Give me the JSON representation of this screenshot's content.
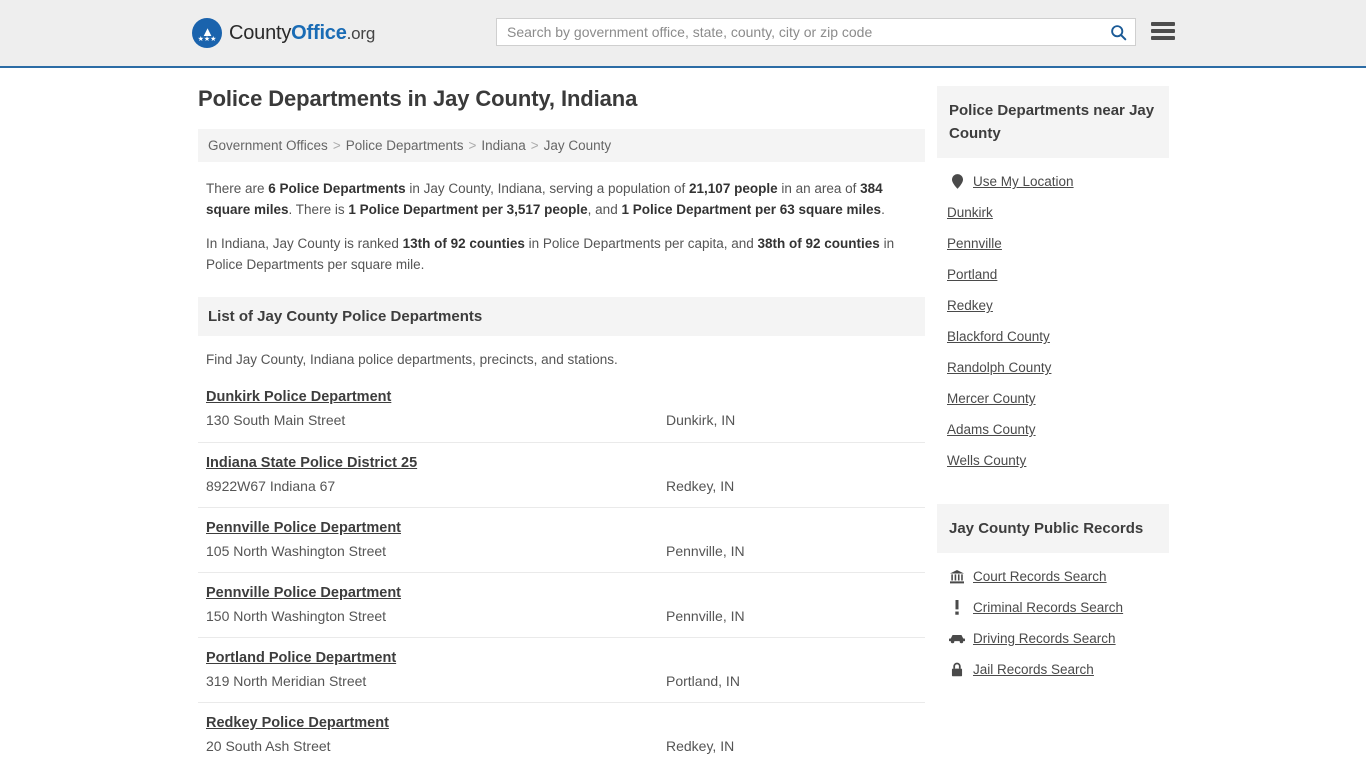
{
  "header": {
    "brand": {
      "part1": "County",
      "part2": "Office",
      "part3": ".org",
      "logo_icon": "eagle-seal-icon"
    },
    "search": {
      "placeholder": "Search by government office, state, county, city or zip code",
      "value": "",
      "search_icon": "search-icon"
    },
    "menu_icon": "hamburger-menu-icon",
    "accent_color": "#2c6ca5"
  },
  "main": {
    "title": "Police Departments in Jay County, Indiana",
    "breadcrumb": [
      {
        "label": "Government Offices"
      },
      {
        "label": "Police Departments"
      },
      {
        "label": "Indiana"
      },
      {
        "label": "Jay County"
      }
    ],
    "breadcrumb_separator": ">",
    "stats": {
      "paragraph1_parts": [
        {
          "text": "There are ",
          "bold": false
        },
        {
          "text": "6 Police Departments",
          "bold": true
        },
        {
          "text": " in Jay County, Indiana, serving a population of ",
          "bold": false
        },
        {
          "text": "21,107 people",
          "bold": true
        },
        {
          "text": " in an area of ",
          "bold": false
        },
        {
          "text": "384 square miles",
          "bold": true
        },
        {
          "text": ". There is ",
          "bold": false
        },
        {
          "text": "1 Police Department per 3,517 people",
          "bold": true
        },
        {
          "text": ", and ",
          "bold": false
        },
        {
          "text": "1 Police Department per 63 square miles",
          "bold": true
        },
        {
          "text": ".",
          "bold": false
        }
      ],
      "paragraph2_parts": [
        {
          "text": "In Indiana, Jay County is ranked ",
          "bold": false
        },
        {
          "text": "13th of 92 counties",
          "bold": true
        },
        {
          "text": " in Police Departments per capita, and ",
          "bold": false
        },
        {
          "text": "38th of 92 counties",
          "bold": true
        },
        {
          "text": " in Police Departments per square mile.",
          "bold": false
        }
      ]
    },
    "list_section": {
      "heading": "List of Jay County Police Departments",
      "subtext": "Find Jay County, Indiana police departments, precincts, and stations."
    },
    "listings": [
      {
        "name": "Dunkirk Police Department",
        "address": "130 South Main Street",
        "city": "Dunkirk, IN"
      },
      {
        "name": "Indiana State Police District 25",
        "address": "8922W67 Indiana 67",
        "city": "Redkey, IN"
      },
      {
        "name": "Pennville Police Department",
        "address": "105 North Washington Street",
        "city": "Pennville, IN"
      },
      {
        "name": "Pennville Police Department",
        "address": "150 North Washington Street",
        "city": "Pennville, IN"
      },
      {
        "name": "Portland Police Department",
        "address": "319 North Meridian Street",
        "city": "Portland, IN"
      },
      {
        "name": "Redkey Police Department",
        "address": "20 South Ash Street",
        "city": "Redkey, IN"
      }
    ]
  },
  "sidebar": {
    "near_section": {
      "heading": "Police Departments near Jay County",
      "items": [
        {
          "label": "Use My Location",
          "icon": "map-pin-icon"
        },
        {
          "label": "Dunkirk",
          "icon": ""
        },
        {
          "label": "Pennville",
          "icon": ""
        },
        {
          "label": "Portland",
          "icon": ""
        },
        {
          "label": "Redkey",
          "icon": ""
        },
        {
          "label": "Blackford County",
          "icon": ""
        },
        {
          "label": "Randolph County",
          "icon": ""
        },
        {
          "label": "Mercer County",
          "icon": ""
        },
        {
          "label": "Adams County",
          "icon": ""
        },
        {
          "label": "Wells County",
          "icon": ""
        }
      ]
    },
    "records_section": {
      "heading": "Jay County Public Records",
      "items": [
        {
          "label": "Court Records Search",
          "icon": "bank-building-icon",
          "glyph": "ἽB"
        },
        {
          "label": "Criminal Records Search",
          "icon": "exclamation-icon",
          "glyph": "!"
        },
        {
          "label": "Driving Records Search",
          "icon": "car-icon",
          "glyph": "car"
        },
        {
          "label": "Jail Records Search",
          "icon": "lock-icon",
          "glyph": "lock"
        }
      ]
    }
  }
}
